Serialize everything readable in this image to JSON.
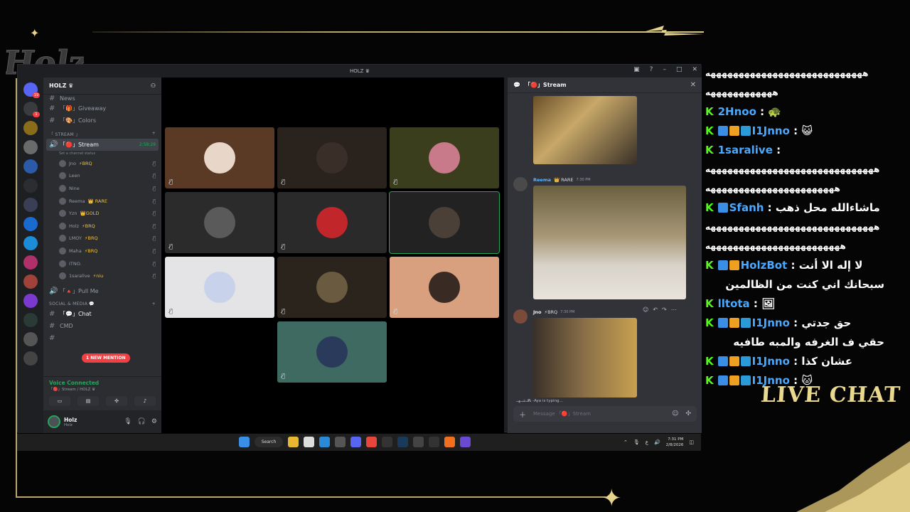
{
  "overlay": {
    "logo_text": "Holz",
    "live_chat_label": "LIVE CHAT",
    "colors": {
      "gold": "#d8c680",
      "kick_green": "#53fc18",
      "name_blue": "#4aa8ff"
    }
  },
  "window": {
    "title": "HOLZ ♛"
  },
  "server": {
    "name": "HOLZ ♛",
    "channels_top": [
      {
        "label": "News"
      },
      {
        "label": "「🎁」Giveaway"
      },
      {
        "label": "「🎨」Colors"
      }
    ],
    "stream_category": "「 STREAM 」",
    "stream_channel": "「🔴」Stream",
    "stream_timer": "2:58:29",
    "channel_status": "Set a channel status",
    "voice_users": [
      {
        "name": "Jno",
        "tag": "⚡BRQ"
      },
      {
        "name": "Leen",
        "tag": ""
      },
      {
        "name": "Nine",
        "tag": ""
      },
      {
        "name": "Reema",
        "tag": "👑 RARE"
      },
      {
        "name": "Yzn",
        "tag": "👑GOLD"
      },
      {
        "name": "Holz",
        "tag": "⚡BRQ"
      },
      {
        "name": "LMOY",
        "tag": "⚡BRQ"
      },
      {
        "name": "Maha",
        "tag": "⚡BRQ"
      },
      {
        "name": "ITNO.",
        "tag": ""
      },
      {
        "name": "1saralive",
        "tag": "⚡niu"
      }
    ],
    "pull_me": "「🔺」Pull Me",
    "social_category": "SOCIAL & MEDIA 💬",
    "chat_channel": "「💬」Chat",
    "cmd_channel": "CMD",
    "mention_badge": "1 NEW MENTION"
  },
  "voice_connected": {
    "title": "Voice Connected",
    "subtitle": "「🔴」Stream / HOLZ ♛"
  },
  "user_panel": {
    "name": "Holz",
    "status": "Holz"
  },
  "stream_panel": {
    "title": "「🔴」Stream",
    "messages": [
      {
        "author": "Reema",
        "role": "👑 RARE",
        "time": "7:30 PM"
      },
      {
        "author": "Jno",
        "role": "⚡BRQ",
        "time": "7:30 PM"
      }
    ],
    "typing": "ـﺷــﻬــ𝓟𝓼 -Aya is typing...",
    "composer_placeholder": "Message 「🔴」Stream"
  },
  "taskbar": {
    "search_label": "Search",
    "time": "7:31 PM",
    "date": "2/8/2026",
    "lang": "ع"
  },
  "live_chat": [
    {
      "type": "cont",
      "text": "ههههههههههههههههههههههههههههه"
    },
    {
      "type": "cont",
      "text": "ههههههههههههه"
    },
    {
      "type": "msg",
      "name": "2Hnoo",
      "badges": 0,
      "text": "🐢"
    },
    {
      "type": "msg",
      "name": "I1Jnno",
      "badges": 3,
      "text": "😺"
    },
    {
      "type": "msg",
      "name": "1saralive",
      "badges": 0,
      "text": ""
    },
    {
      "type": "cont",
      "text": "ههههههههههههههههههههههههههههههه"
    },
    {
      "type": "cont",
      "text": "هههههههههههههههههههههههه"
    },
    {
      "type": "msg_rtl",
      "name": "Sfanh",
      "badges": 1,
      "text": "ماشاءالله محل ذهب"
    },
    {
      "type": "cont",
      "text": "ههههههههههههههههههههههههههههههه"
    },
    {
      "type": "cont",
      "text": "ههههههههههههههههههههههههه"
    },
    {
      "type": "msg_rtl",
      "name": "HolzBot",
      "badges": 2,
      "text": "لا إله الا أنت"
    },
    {
      "type": "cont_rtl",
      "text": "سبحانك اني كنت من الظالمين"
    },
    {
      "type": "msg",
      "name": "lltota",
      "badges": 0,
      "text": "🖼"
    },
    {
      "type": "msg_rtl",
      "name": "I1Jnno",
      "badges": 3,
      "text": "حق جدتي"
    },
    {
      "type": "cont_rtl",
      "text": "حقي ف الغرفه والمبه طافيه"
    },
    {
      "type": "msg_rtl",
      "name": "I1Jnno",
      "badges": 3,
      "text": "عشان كذا"
    },
    {
      "type": "msg",
      "name": "I1Jnno",
      "badges": 3,
      "text": "🐱"
    }
  ]
}
